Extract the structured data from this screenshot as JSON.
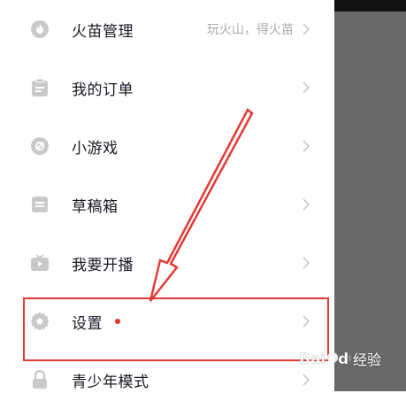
{
  "menu": {
    "items": [
      {
        "label": "火苗管理",
        "sub": "玩火山，得火苗",
        "icon": "flame-icon",
        "badge": false
      },
      {
        "label": "我的订单",
        "sub": "",
        "icon": "order-icon",
        "badge": false
      },
      {
        "label": "小游戏",
        "sub": "",
        "icon": "game-icon",
        "badge": false
      },
      {
        "label": "草稿箱",
        "sub": "",
        "icon": "drafts-icon",
        "badge": false
      },
      {
        "label": "我要开播",
        "sub": "",
        "icon": "live-icon",
        "badge": false
      },
      {
        "label": "设置",
        "sub": "",
        "icon": "gear-icon",
        "badge": true
      },
      {
        "label": "青少年模式",
        "sub": "",
        "icon": "lock-icon",
        "badge": false
      }
    ]
  },
  "watermark": {
    "text": "经验",
    "brand": "Baidu"
  },
  "colors": {
    "annotation": "#e53935",
    "badge": "#e0352b",
    "icon": "#c9c9cc",
    "text": "#161823",
    "subtext": "#a9a9ae",
    "overlay": "#696969"
  }
}
